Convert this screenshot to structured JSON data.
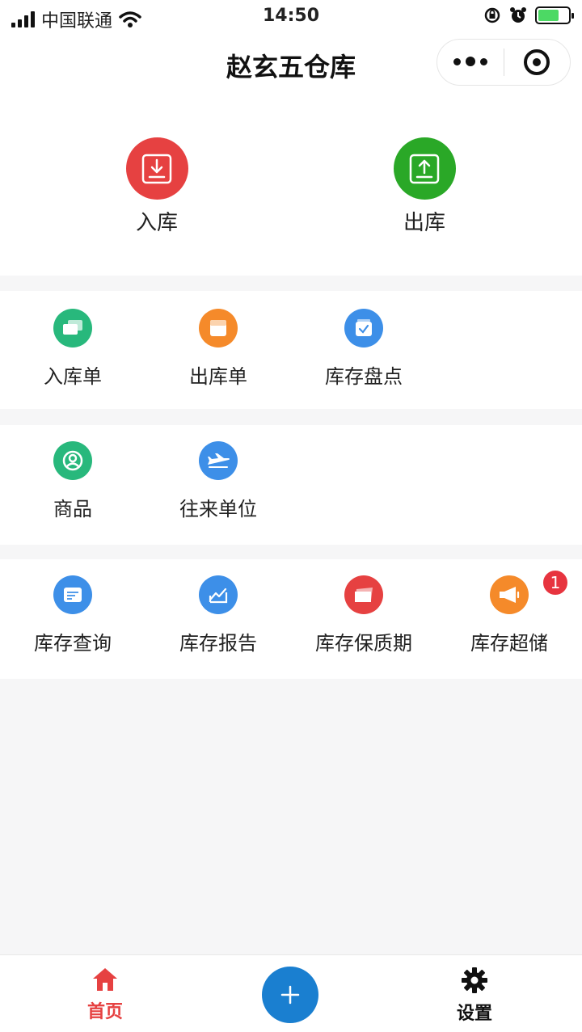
{
  "status_bar": {
    "carrier": "中国联通",
    "time": "14:50"
  },
  "nav": {
    "title": "赵玄五仓库"
  },
  "hero": [
    {
      "label": "入库",
      "color": "#e64141"
    },
    {
      "label": "出库",
      "color": "#2aa827"
    }
  ],
  "sections": [
    {
      "items": [
        {
          "label": "入库单",
          "color": "#28b87c",
          "icon": "chat-icon"
        },
        {
          "label": "出库单",
          "color": "#f58a2a",
          "icon": "document-icon"
        },
        {
          "label": "库存盘点",
          "color": "#3d8fe8",
          "icon": "checklist-icon"
        }
      ]
    },
    {
      "items": [
        {
          "label": "商品",
          "color": "#28b87c",
          "icon": "user-circle-icon"
        },
        {
          "label": "往来单位",
          "color": "#3d8fe8",
          "icon": "airplane-icon"
        }
      ]
    },
    {
      "items": [
        {
          "label": "库存查询",
          "color": "#3d8fe8",
          "icon": "card-icon"
        },
        {
          "label": "库存报告",
          "color": "#3d8fe8",
          "icon": "chart-icon"
        },
        {
          "label": "库存保质期",
          "color": "#e64141",
          "icon": "ticket-icon"
        },
        {
          "label": "库存超储",
          "color": "#f58a2a",
          "icon": "megaphone-icon",
          "badge": "1"
        }
      ]
    }
  ],
  "tabbar": {
    "home_label": "首页",
    "settings_label": "设置",
    "active_color": "#e64141",
    "fab_color": "#1a7fd0"
  }
}
